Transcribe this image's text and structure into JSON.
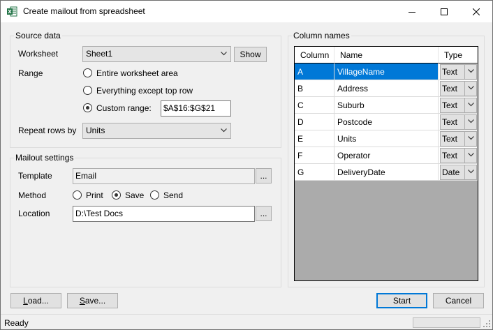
{
  "window": {
    "title": "Create mailout from spreadsheet",
    "icon": "excel-icon",
    "controls": [
      "minimize-icon",
      "maximize-icon",
      "close-icon"
    ]
  },
  "source_data": {
    "group_title": "Source data",
    "worksheet_label": "Worksheet",
    "worksheet_value": "Sheet1",
    "show_button": "Show",
    "range_label": "Range",
    "range_options": [
      "Entire worksheet area",
      "Everything except top row",
      "Custom range:"
    ],
    "range_selected": "Custom range:",
    "custom_range_value": "$A$16:$G$21",
    "repeat_label": "Repeat rows by",
    "repeat_value": "Units"
  },
  "mailout_settings": {
    "group_title": "Mailout settings",
    "template_label": "Template",
    "template_value": "Email",
    "browse_label": "...",
    "method_label": "Method",
    "method_options": [
      "Print",
      "Save",
      "Send"
    ],
    "method_selected": "Save",
    "location_label": "Location",
    "location_value": "D:\\Test Docs"
  },
  "column_names": {
    "group_title": "Column names",
    "headers": [
      "Column",
      "Name",
      "Type"
    ],
    "rows": [
      {
        "column": "A",
        "name": "VillageName",
        "type": "Text",
        "selected": true
      },
      {
        "column": "B",
        "name": "Address",
        "type": "Text"
      },
      {
        "column": "C",
        "name": "Suburb",
        "type": "Text"
      },
      {
        "column": "D",
        "name": "Postcode",
        "type": "Text"
      },
      {
        "column": "E",
        "name": "Units",
        "type": "Text"
      },
      {
        "column": "F",
        "name": "Operator",
        "type": "Text"
      },
      {
        "column": "G",
        "name": "DeliveryDate",
        "type": "Date"
      }
    ]
  },
  "buttons": {
    "load_access": "L",
    "load_rest": "oad...",
    "save_access": "S",
    "save_rest": "ave...",
    "start": "Start",
    "cancel": "Cancel"
  },
  "status": {
    "text": "Ready",
    "progress": 0
  },
  "colors": {
    "selection": "#0078d7",
    "grid_background": "#ababab"
  }
}
